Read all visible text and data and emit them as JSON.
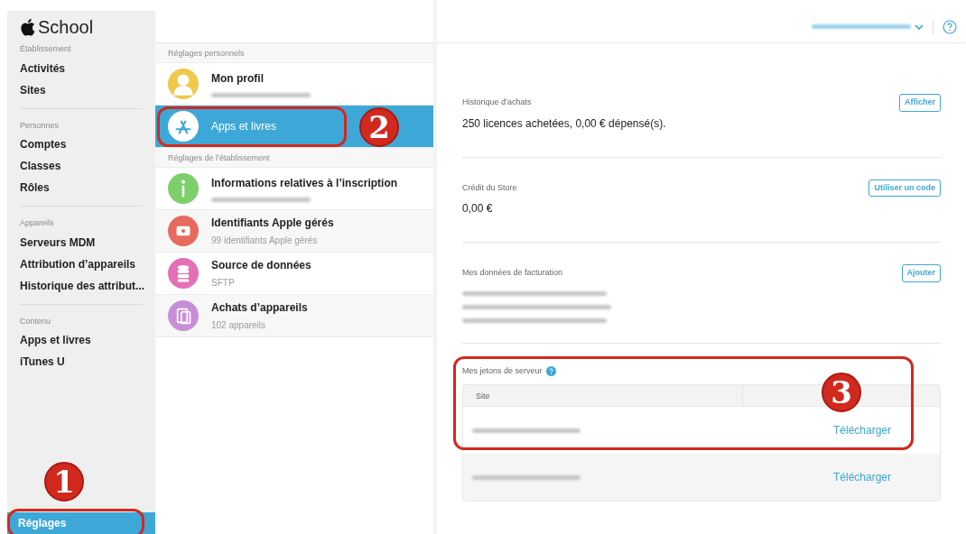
{
  "brand": {
    "name": "School"
  },
  "sidebar": {
    "groups": [
      {
        "heading": "Établissement",
        "items": [
          {
            "label": "Activités",
            "selected": false
          },
          {
            "label": "Sites",
            "selected": false
          }
        ]
      },
      {
        "heading": "Personnes",
        "items": [
          {
            "label": "Comptes",
            "selected": false
          },
          {
            "label": "Classes",
            "selected": false
          },
          {
            "label": "Rôles",
            "selected": false
          }
        ]
      },
      {
        "heading": "Appareils",
        "items": [
          {
            "label": "Serveurs MDM",
            "selected": false
          },
          {
            "label": "Attribution d’appareils",
            "selected": false
          },
          {
            "label": "Historique des attribut...",
            "selected": false
          }
        ]
      },
      {
        "heading": "Contenu",
        "items": [
          {
            "label": "Apps et livres",
            "selected": false
          },
          {
            "label": "iTunes U",
            "selected": false
          }
        ]
      }
    ],
    "footer_item": {
      "label": "Réglages",
      "selected": true,
      "callout": "1"
    }
  },
  "settings_list": {
    "sections": [
      {
        "heading": "Réglages personnels",
        "items": [
          {
            "title": "Mon profil",
            "kind": "person",
            "color": "#f0c84a",
            "redacted_subtitle": true,
            "selected": false
          },
          {
            "title": "Apps et livres",
            "kind": "appstore",
            "color": "#ffffff",
            "redacted_subtitle": false,
            "selected": true,
            "callout": "2"
          }
        ]
      },
      {
        "heading": "Réglages de l’établissement",
        "items": [
          {
            "title": "Informations relatives à l’inscription",
            "kind": "info",
            "color": "#7ccf6a",
            "redacted_subtitle": true,
            "selected": false
          },
          {
            "title": "Identifiants Apple gérés",
            "subtitle": "99 identifiants Apple gérés",
            "kind": "card",
            "color": "#e8695e",
            "redacted_subtitle": false,
            "selected": false
          },
          {
            "title": "Source de données",
            "subtitle": "SFTP",
            "kind": "database",
            "color": "#e46fb4",
            "redacted_subtitle": false,
            "selected": false
          },
          {
            "title": "Achats d’appareils",
            "subtitle": "102 appareils",
            "kind": "devices",
            "color": "#c98fd6",
            "redacted_subtitle": false,
            "selected": false
          }
        ]
      }
    ]
  },
  "detail": {
    "sections": [
      {
        "kind": "value",
        "heading": "Historique d’achats",
        "value": "250 licences achetées, 0,00 € dépensé(s).",
        "action": "Afficher"
      },
      {
        "kind": "value",
        "heading": "Crédit du Store",
        "value": "0,00 €",
        "action": "Utiliser un code"
      },
      {
        "kind": "redacted",
        "heading": "Mes données de facturation",
        "action": "Ajouter"
      }
    ],
    "tokens": {
      "heading": "Mes jetons de serveur",
      "columns": [
        "Site"
      ],
      "callout": "3",
      "rows": [
        {
          "action": "Télécharger"
        },
        {
          "action": "Télécharger"
        }
      ]
    }
  }
}
